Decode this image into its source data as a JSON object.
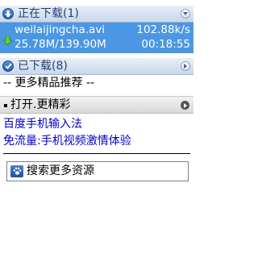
{
  "downloading": {
    "title": "正在下载(1)",
    "item": {
      "filename": "weilaijingcha.avi",
      "speed": "102.88k/s",
      "size": "25.78M/139.90M",
      "time": "00:18:55"
    }
  },
  "downloaded": {
    "title": "已下载(8)"
  },
  "more_recommend": "-- 更多精品推荐 --",
  "open_more": "打开.更精彩",
  "links": [
    "百度手机输入法",
    "免流量:手机视频激情体验"
  ],
  "search_label": "搜索更多资源",
  "icons": {
    "downloading_header": "download-circle-icon",
    "downloaded_header": "check-circle-icon",
    "collapse": "chevron-down-icon",
    "expand": "chevron-right-icon",
    "download_item": "green-down-arrow-icon",
    "search": "paw-search-icon"
  },
  "colors": {
    "selected_row": "#4b97e3",
    "link": "#0000cc",
    "header_text": "#1f3f7a"
  }
}
